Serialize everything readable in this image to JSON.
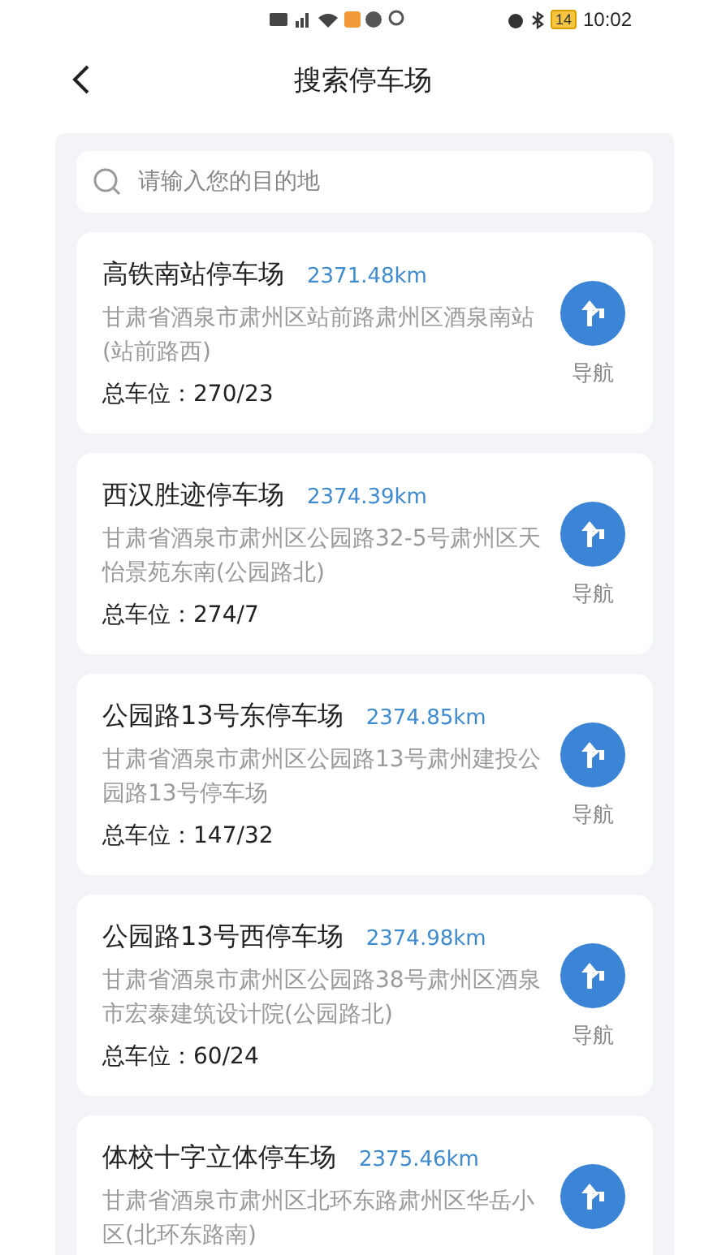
{
  "status_bar": {
    "battery": "14",
    "time": "10:02"
  },
  "header": {
    "title": "搜索停车场"
  },
  "search": {
    "placeholder": "请输入您的目的地"
  },
  "parking_lots": [
    {
      "name": "高铁南站停车场",
      "distance": "2371.48km",
      "address": "甘肃省酒泉市肃州区站前路肃州区酒泉南站(站前路西)",
      "spaces": "总车位：270/23",
      "nav_label": "导航"
    },
    {
      "name": "西汉胜迹停车场",
      "distance": "2374.39km",
      "address": "甘肃省酒泉市肃州区公园路32-5号肃州区天怡景苑东南(公园路北)",
      "spaces": "总车位：274/7",
      "nav_label": "导航"
    },
    {
      "name": "公园路13号东停车场",
      "distance": "2374.85km",
      "address": "甘肃省酒泉市肃州区公园路13号肃州建投公园路13号停车场",
      "spaces": "总车位：147/32",
      "nav_label": "导航"
    },
    {
      "name": "公园路13号西停车场",
      "distance": "2374.98km",
      "address": "甘肃省酒泉市肃州区公园路38号肃州区酒泉市宏泰建筑设计院(公园路北)",
      "spaces": "总车位：60/24",
      "nav_label": "导航"
    },
    {
      "name": "体校十字立体停车场",
      "distance": "2375.46km",
      "address": "甘肃省酒泉市肃州区北环东路肃州区华岳小区(北环东路南)"
    }
  ]
}
